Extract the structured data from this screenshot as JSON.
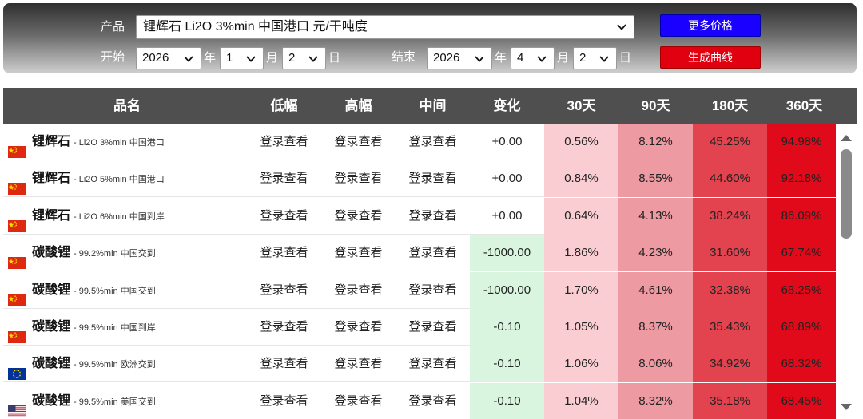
{
  "controls": {
    "product_label": "产品",
    "product_value": "锂辉石 Li2O 3%min 中国港口 元/干吨度",
    "more_prices": "更多价格",
    "generate_curve": "生成曲线",
    "start_label": "开始",
    "end_label": "结束",
    "start": {
      "year": "2026",
      "month": "1",
      "day": "2"
    },
    "end": {
      "year": "2026",
      "month": "4",
      "day": "2"
    },
    "year_unit": "年",
    "month_unit": "月",
    "day_unit": "日"
  },
  "table": {
    "headers": [
      "品名",
      "低幅",
      "高幅",
      "中间",
      "变化",
      "30天",
      "90天",
      "180天",
      "360天"
    ],
    "rows": [
      {
        "flag": "cn",
        "name": "锂辉石",
        "spec": "Li2O 3%min 中国港口",
        "low": "登录查看",
        "high": "登录查看",
        "mid": "登录查看",
        "change": "+0.00",
        "d30": "0.56%",
        "d90": "8.12%",
        "d180": "45.25%",
        "d360": "94.98%"
      },
      {
        "flag": "cn",
        "name": "锂辉石",
        "spec": "Li2O 5%min 中国港口",
        "low": "登录查看",
        "high": "登录查看",
        "mid": "登录查看",
        "change": "+0.00",
        "d30": "0.84%",
        "d90": "8.55%",
        "d180": "44.60%",
        "d360": "92.18%"
      },
      {
        "flag": "cn",
        "name": "锂辉石",
        "spec": "Li2O 6%min 中国到岸",
        "low": "登录查看",
        "high": "登录查看",
        "mid": "登录查看",
        "change": "+0.00",
        "d30": "0.64%",
        "d90": "4.13%",
        "d180": "38.24%",
        "d360": "86.09%"
      },
      {
        "flag": "cn",
        "name": "碳酸锂",
        "spec": "99.2%min 中国交到",
        "low": "登录查看",
        "high": "登录查看",
        "mid": "登录查看",
        "change": "-1000.00",
        "d30": "1.86%",
        "d90": "4.23%",
        "d180": "31.60%",
        "d360": "67.74%"
      },
      {
        "flag": "cn",
        "name": "碳酸锂",
        "spec": "99.5%min 中国交到",
        "low": "登录查看",
        "high": "登录查看",
        "mid": "登录查看",
        "change": "-1000.00",
        "d30": "1.70%",
        "d90": "4.61%",
        "d180": "32.38%",
        "d360": "68.25%"
      },
      {
        "flag": "cn",
        "name": "碳酸锂",
        "spec": "99.5%min 中国到岸",
        "low": "登录查看",
        "high": "登录查看",
        "mid": "登录查看",
        "change": "-0.10",
        "d30": "1.05%",
        "d90": "8.37%",
        "d180": "35.43%",
        "d360": "68.89%"
      },
      {
        "flag": "eu",
        "name": "碳酸锂",
        "spec": "99.5%min 欧洲交到",
        "low": "登录查看",
        "high": "登录查看",
        "mid": "登录查看",
        "change": "-0.10",
        "d30": "1.06%",
        "d90": "8.06%",
        "d180": "34.92%",
        "d360": "68.32%"
      },
      {
        "flag": "us",
        "name": "碳酸锂",
        "spec": "99.5%min 美国交到",
        "low": "登录查看",
        "high": "登录查看",
        "mid": "登录查看",
        "change": "-0.10",
        "d30": "1.04%",
        "d90": "8.32%",
        "d180": "35.18%",
        "d360": "68.45%"
      }
    ]
  },
  "colors": {
    "blue_button": "#1a00ff",
    "red_button": "#e1000f",
    "header_bg": "#4f4f4f",
    "change_negative_bg": "#d9f5df",
    "d30_bg": "#f9cdd1",
    "d90_bg": "#ee9aa3",
    "d180_bg": "#e3424f",
    "d360_bg": "#e00a1a"
  },
  "icons": {
    "dropdown": "chevron-down-icon",
    "flags": [
      "china-flag-icon",
      "eu-flag-icon",
      "us-flag-icon"
    ],
    "scroll": [
      "scroll-up-icon",
      "scroll-down-icon"
    ]
  }
}
